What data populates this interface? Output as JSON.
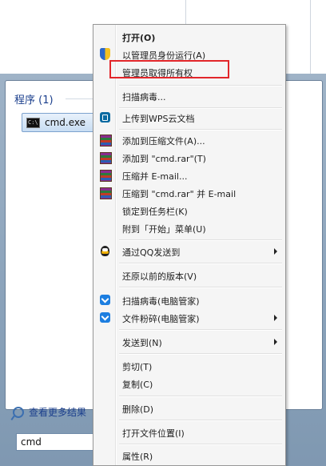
{
  "start_menu": {
    "section_title": "程序 (1)",
    "result_item": "cmd.exe",
    "see_more": "查看更多结果",
    "search_value": "cmd"
  },
  "context_menu": {
    "items": [
      {
        "label": "打开(O)",
        "bold": true,
        "icon": "none"
      },
      {
        "label": "以管理员身份运行(A)",
        "icon": "uac-shield-icon"
      },
      {
        "label": "管理员取得所有权",
        "icon": "none",
        "highlighted": true
      },
      {
        "label": "扫描病毒...",
        "icon": "none"
      },
      {
        "label": "上传到WPS云文档",
        "icon": "wps-cloud-icon"
      },
      {
        "label": "添加到压缩文件(A)...",
        "icon": "winrar-icon"
      },
      {
        "label": "添加到 \"cmd.rar\"(T)",
        "icon": "winrar-icon"
      },
      {
        "label": "压缩并 E-mail...",
        "icon": "winrar-icon"
      },
      {
        "label": "压缩到 \"cmd.rar\" 并 E-mail",
        "icon": "winrar-icon"
      },
      {
        "label": "锁定到任务栏(K)",
        "icon": "none"
      },
      {
        "label": "附到「开始」菜单(U)",
        "icon": "none"
      },
      {
        "label": "通过QQ发送到",
        "icon": "qq-icon",
        "submenu": true
      },
      {
        "label": "还原以前的版本(V)",
        "icon": "none"
      },
      {
        "label": "扫描病毒(电脑管家)",
        "icon": "tencent-guard-icon"
      },
      {
        "label": "文件粉碎(电脑管家)",
        "icon": "tencent-guard-icon",
        "submenu": true
      },
      {
        "label": "发送到(N)",
        "icon": "none",
        "submenu": true
      },
      {
        "label": "剪切(T)",
        "icon": "none"
      },
      {
        "label": "复制(C)",
        "icon": "none"
      },
      {
        "label": "删除(D)",
        "icon": "none"
      },
      {
        "label": "打开文件位置(I)",
        "icon": "none"
      },
      {
        "label": "属性(R)",
        "icon": "none"
      }
    ]
  },
  "colors": {
    "highlight_border": "#e2262a",
    "menu_background": "#f5f5f5",
    "link_blue": "#1a3e8c"
  }
}
